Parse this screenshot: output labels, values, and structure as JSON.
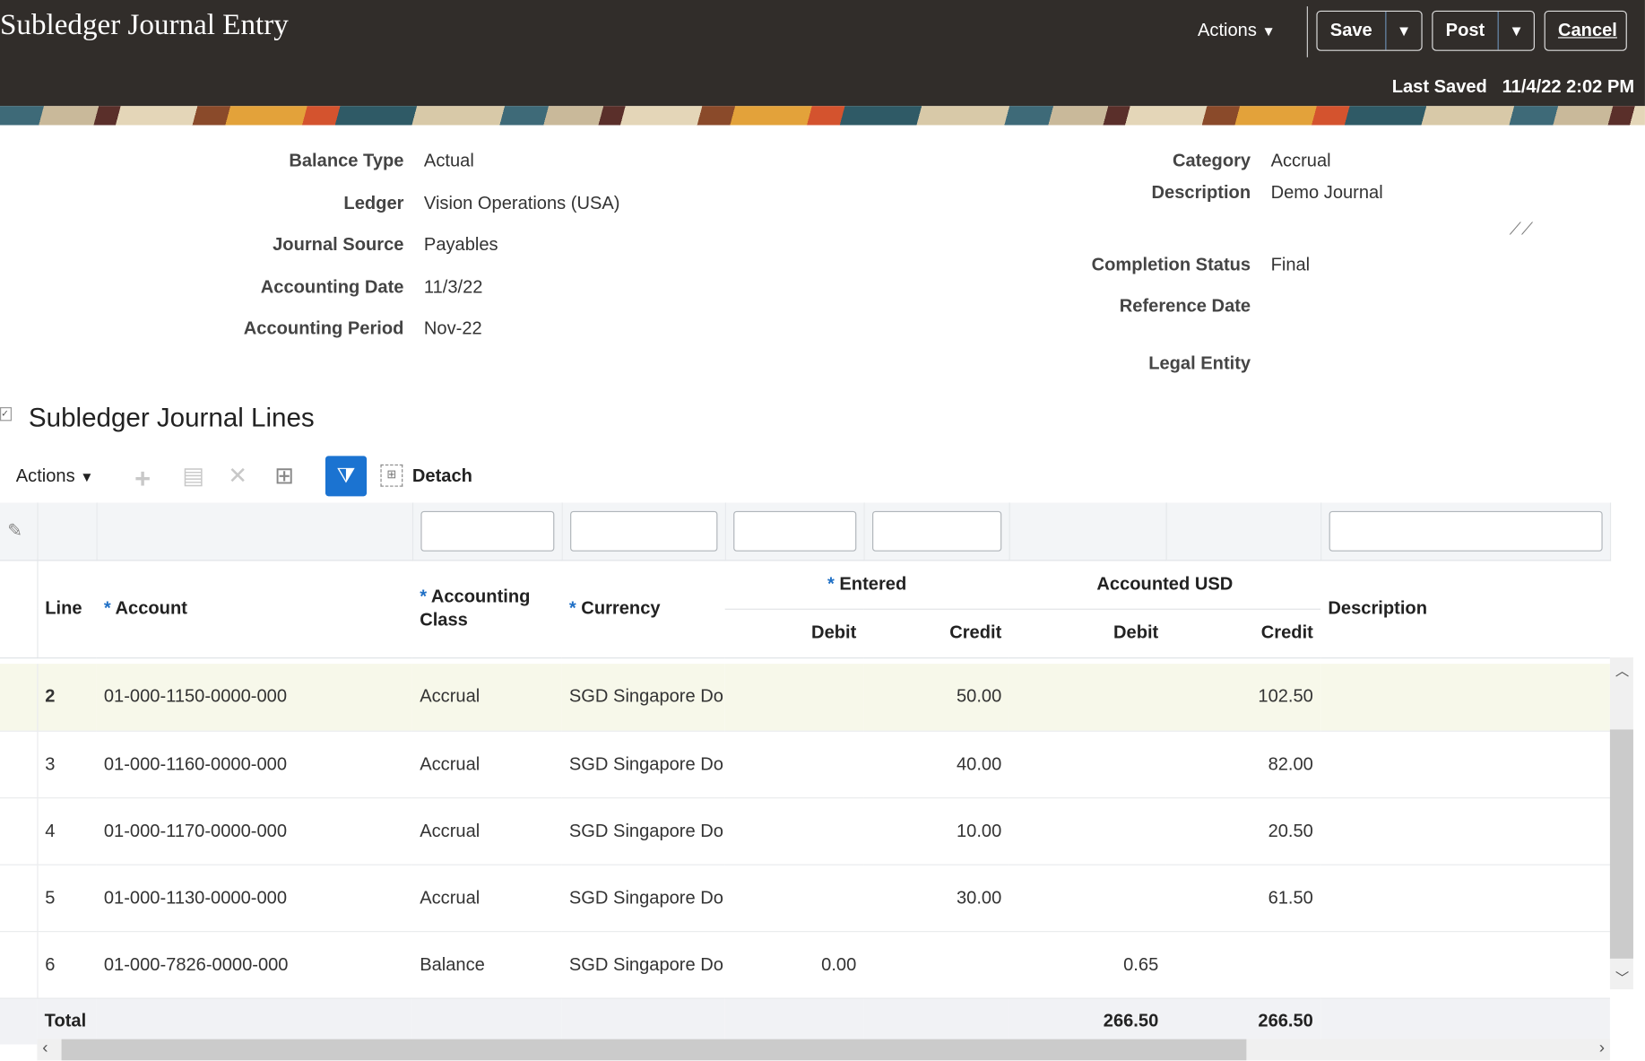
{
  "header": {
    "title": "Subledger Journal Entry",
    "actions": "Actions",
    "save": "Save",
    "post": "Post",
    "cancel": "Cancel",
    "last_saved_label": "Last Saved",
    "last_saved_value": "11/4/22 2:02 PM"
  },
  "form": {
    "left": [
      {
        "label": "Balance Type",
        "value": "Actual"
      },
      {
        "label": "Ledger",
        "value": "Vision Operations (USA)"
      },
      {
        "label": "Journal Source",
        "value": "Payables"
      },
      {
        "label": "Accounting Date",
        "value": "11/3/22"
      },
      {
        "label": "Accounting Period",
        "value": "Nov-22"
      }
    ],
    "right": [
      {
        "label": "Category",
        "value": "Accrual"
      },
      {
        "label": "Description",
        "value": "Demo Journal"
      },
      {
        "label": "Completion Status",
        "value": "Final"
      },
      {
        "label": "Reference Date",
        "value": ""
      },
      {
        "label": "Legal Entity",
        "value": ""
      }
    ]
  },
  "section": {
    "title": "Subledger Journal Lines",
    "actions": "Actions",
    "detach": "Detach"
  },
  "table": {
    "headers": {
      "line": "Line",
      "account": "Account",
      "accounting_class": "Accounting Class",
      "currency": "Currency",
      "entered": "Entered",
      "accounted": "Accounted USD",
      "debit": "Debit",
      "credit": "Credit",
      "description": "Description"
    },
    "rows": [
      {
        "line": "2",
        "account": "01-000-1150-0000-000",
        "class": "Accrual",
        "currency": "SGD Singapore Do",
        "ent_debit": "",
        "ent_credit": "50.00",
        "acc_debit": "",
        "acc_credit": "102.50",
        "description": ""
      },
      {
        "line": "3",
        "account": "01-000-1160-0000-000",
        "class": "Accrual",
        "currency": "SGD Singapore Do",
        "ent_debit": "",
        "ent_credit": "40.00",
        "acc_debit": "",
        "acc_credit": "82.00",
        "description": ""
      },
      {
        "line": "4",
        "account": "01-000-1170-0000-000",
        "class": "Accrual",
        "currency": "SGD Singapore Do",
        "ent_debit": "",
        "ent_credit": "10.00",
        "acc_debit": "",
        "acc_credit": "20.50",
        "description": ""
      },
      {
        "line": "5",
        "account": "01-000-1130-0000-000",
        "class": "Accrual",
        "currency": "SGD Singapore Do",
        "ent_debit": "",
        "ent_credit": "30.00",
        "acc_debit": "",
        "acc_credit": "61.50",
        "description": ""
      },
      {
        "line": "6",
        "account": "01-000-7826-0000-000",
        "class": "Balance",
        "currency": "SGD Singapore Do",
        "ent_debit": "0.00",
        "ent_credit": "",
        "acc_debit": "0.65",
        "acc_credit": "",
        "description": ""
      }
    ],
    "total": {
      "label": "Total",
      "acc_debit": "266.50",
      "acc_credit": "266.50"
    }
  }
}
